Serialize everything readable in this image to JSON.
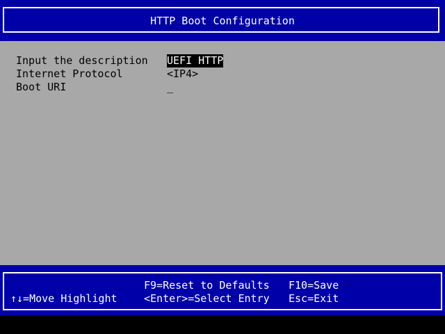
{
  "header": {
    "title": "HTTP Boot Configuration"
  },
  "form": {
    "fields": [
      {
        "label": "Input the description",
        "value": "UEFI HTTP"
      },
      {
        "label": "Internet Protocol",
        "value": "<IP4>"
      },
      {
        "label": "Boot URI",
        "value": "_"
      }
    ]
  },
  "footer": {
    "move_highlight": "↑↓=Move Highlight",
    "reset_defaults": "F9=Reset to Defaults",
    "select_entry": "<Enter>=Select Entry",
    "save": "F10=Save",
    "exit": "Esc=Exit"
  },
  "colors": {
    "header_bg": "#0000a8",
    "main_bg": "#a8a8a8",
    "text_light": "#ffffff",
    "text_dark": "#000000",
    "highlight_bg": "#000000"
  }
}
